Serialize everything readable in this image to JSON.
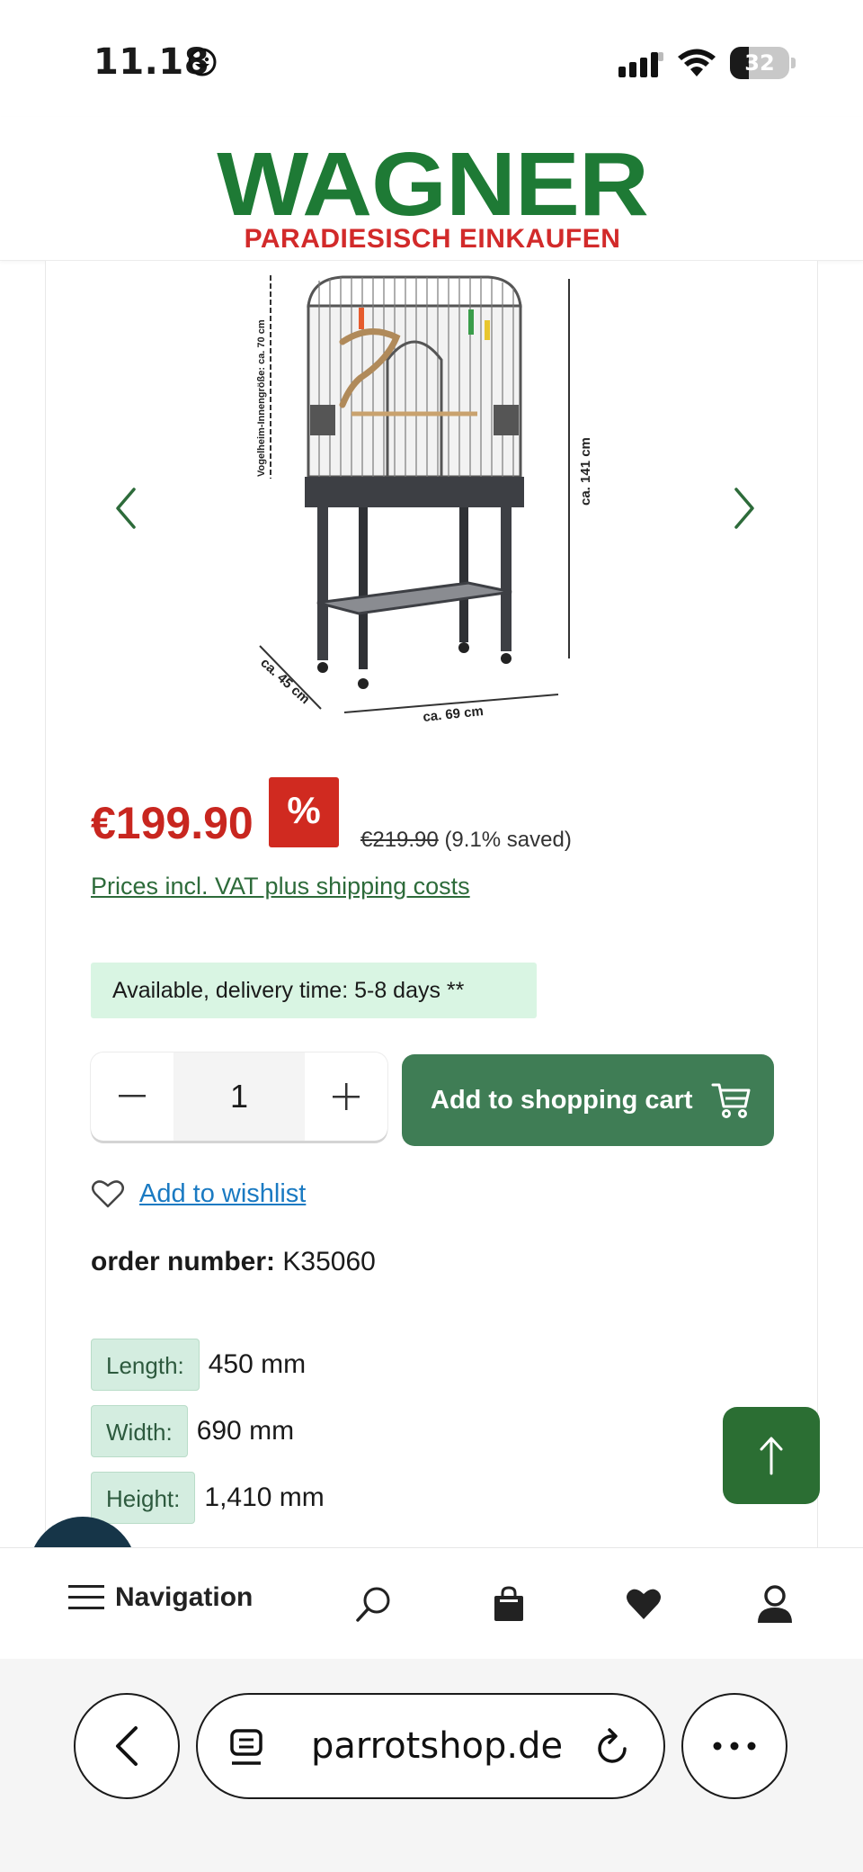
{
  "status_bar": {
    "time": "11.18",
    "battery": "32",
    "battery_level": 0.32
  },
  "header": {
    "logo_main": "WAGNER",
    "logo_sub": "PARADIESISCH EINKAUFEN",
    "colors": {
      "logo_green": "#1e7a35",
      "logo_red": "#d22a2a"
    }
  },
  "product": {
    "image_labels": {
      "inner_size": "Vogelheim-Innengröße: ca. 70 cm",
      "height": "ca. 141 cm",
      "depth": "ca. 45 cm",
      "width": "ca. 69 cm"
    },
    "price": "€199.90",
    "discount_badge": "%",
    "old_price": "€219.90",
    "saved": "(9.1% saved)",
    "vat_link": "Prices incl. VAT plus shipping costs",
    "availability": "Available, delivery time: 5-8 days **",
    "quantity": "1",
    "add_to_cart": "Add to shopping cart",
    "wishlist": "Add to wishlist",
    "order_number_label": "order number:",
    "order_number": "K35060",
    "specs": [
      {
        "label": "Length:",
        "value": "450 mm"
      },
      {
        "label": "Width:",
        "value": "690 mm"
      },
      {
        "label": "Height:",
        "value": "1,410 mm"
      }
    ],
    "colors": {
      "price_red": "#c8261f",
      "cart_green": "#3f7d55",
      "availability_bg": "#d9f5e3"
    }
  },
  "shop_nav": {
    "navigation_label": "Navigation",
    "icons": [
      "menu-icon",
      "search-icon",
      "bag-icon",
      "heart-icon",
      "user-icon"
    ]
  },
  "browser": {
    "url": "parrotshop.de"
  }
}
